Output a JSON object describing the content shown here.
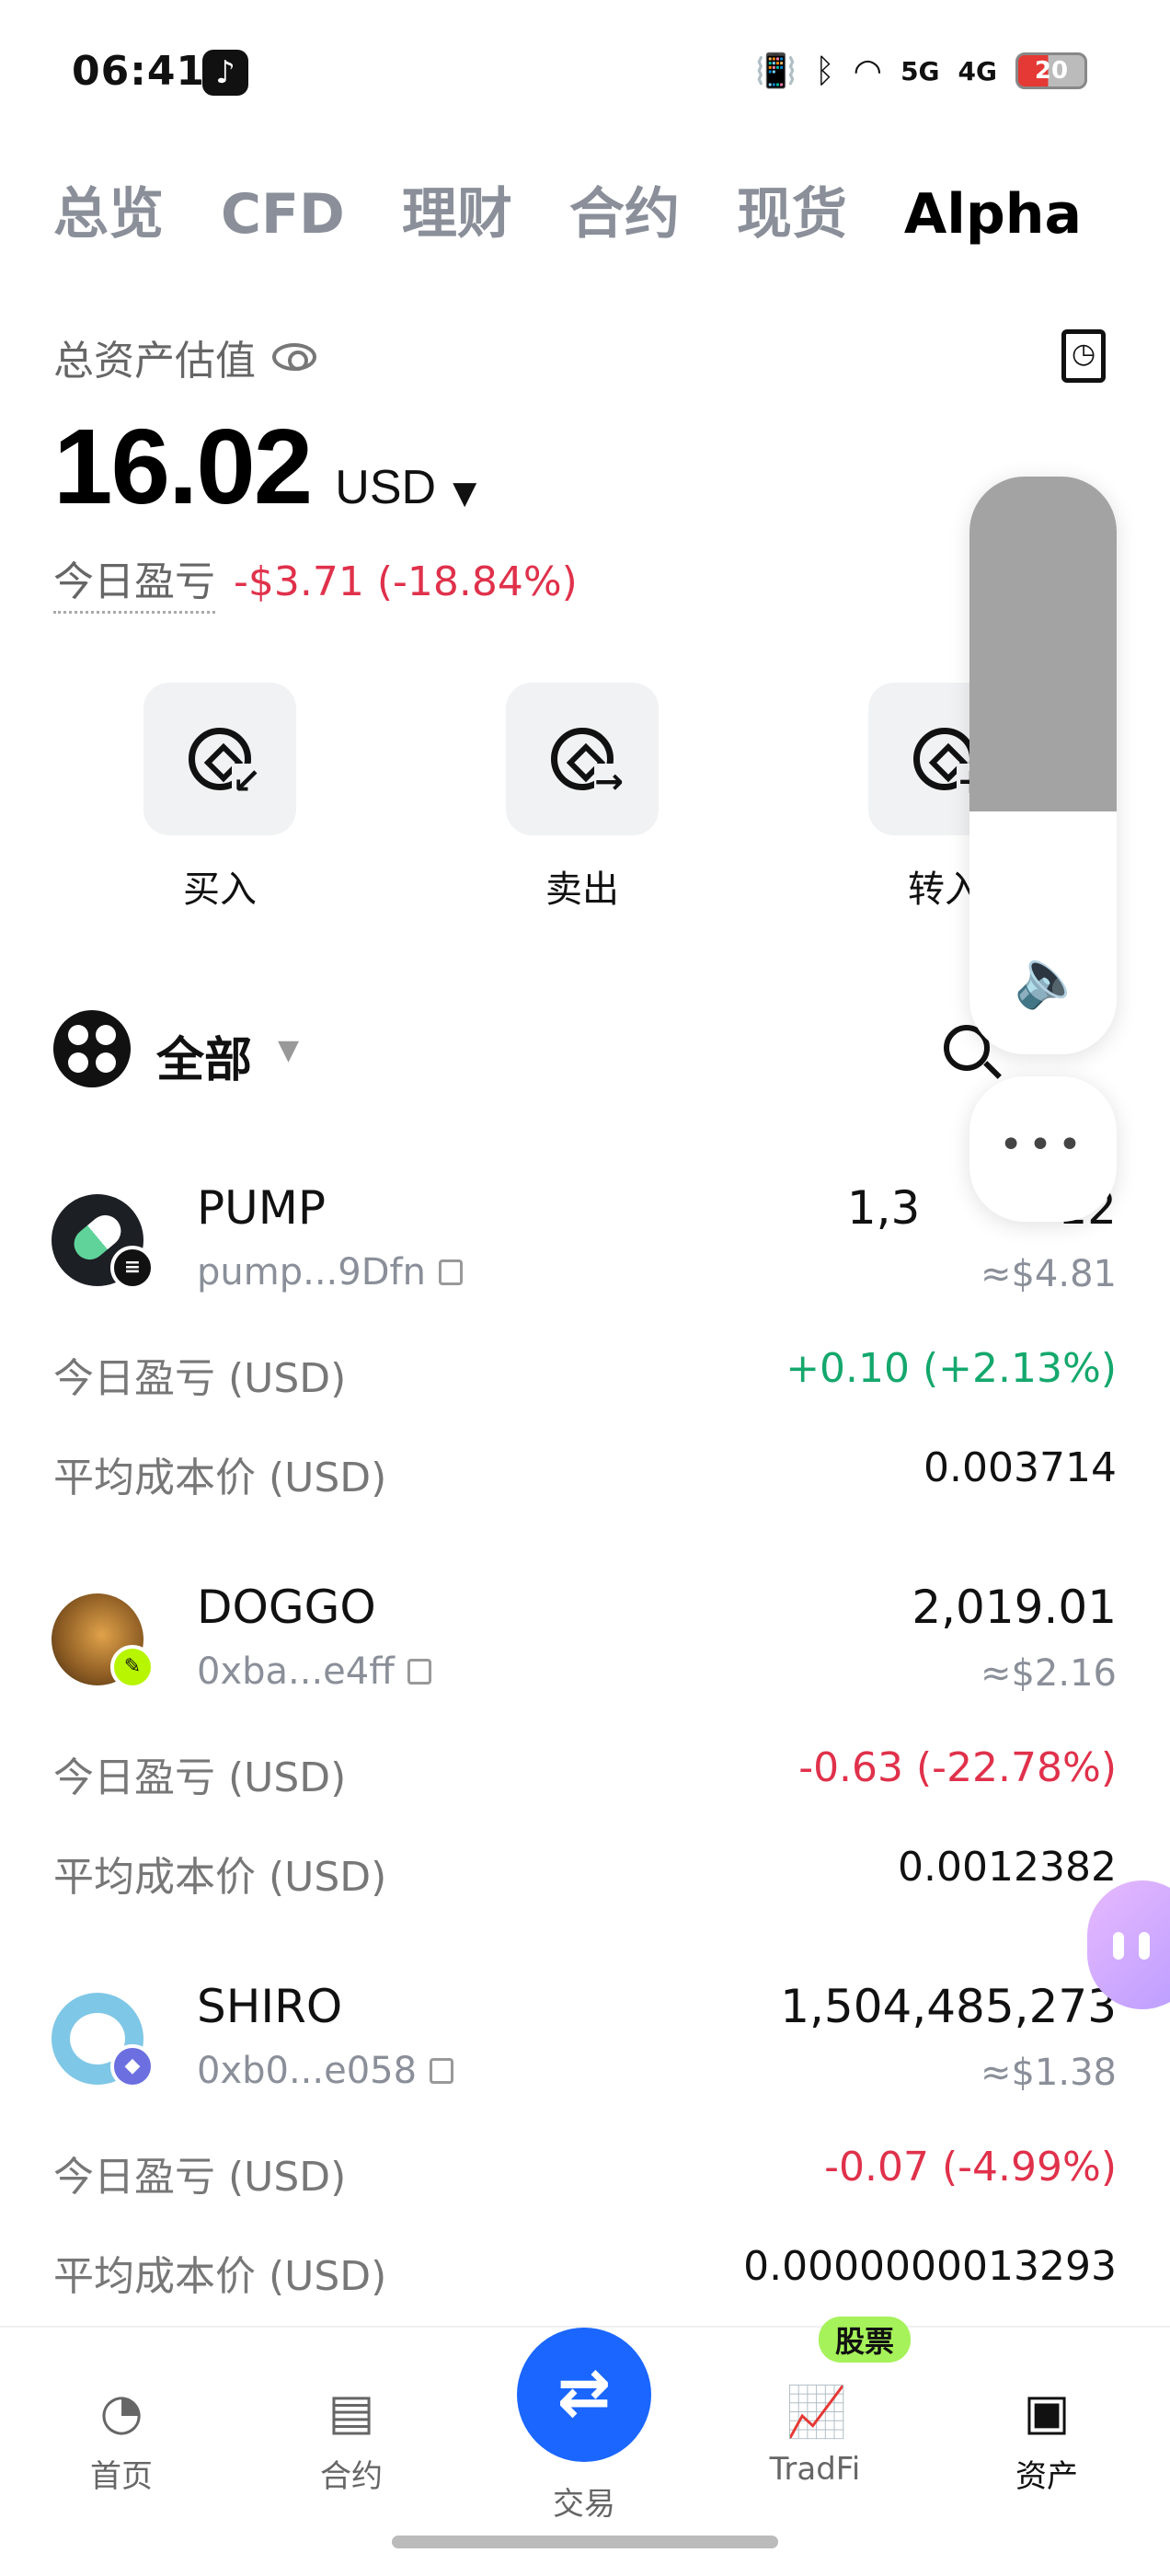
{
  "status_bar": {
    "time": "06:41",
    "network_5g": "5G",
    "network_4g": "4G",
    "battery": "20"
  },
  "tabs": [
    {
      "label": "总览",
      "active": false
    },
    {
      "label": "CFD",
      "active": false
    },
    {
      "label": "理财",
      "active": false
    },
    {
      "label": "合约",
      "active": false
    },
    {
      "label": "现货",
      "active": false
    },
    {
      "label": "Alpha",
      "active": true
    }
  ],
  "summary": {
    "total_label": "总资产估值",
    "balance": "16.02",
    "currency": "USD",
    "pnl_label": "今日盈亏",
    "pnl_value": "-$3.71 (-18.84%)"
  },
  "actions": [
    {
      "label": "买入",
      "icon": "buy-icon"
    },
    {
      "label": "卖出",
      "icon": "sell-icon"
    },
    {
      "label": "转入",
      "icon": "transfer-in-icon"
    }
  ],
  "filter": {
    "label": "全部"
  },
  "tokens": [
    {
      "name": "PUMP",
      "address": "pump...9Dfn",
      "amount": "1,3",
      "amount_tail": "12",
      "usd": "≈$4.81",
      "pnl_label": "今日盈亏 (USD)",
      "pnl_value": "+0.10 (+2.13%)",
      "pnl_color": "#14a86c",
      "cost_label": "平均成本价 (USD)",
      "cost_value": "0.003714",
      "chain": "solana"
    },
    {
      "name": "DOGGO",
      "address": "0xba...e4ff",
      "amount": "2,019.01",
      "usd": "≈$2.16",
      "pnl_label": "今日盈亏 (USD)",
      "pnl_value": "-0.63 (-22.78%)",
      "pnl_color": "#e0314b",
      "cost_label": "平均成本价 (USD)",
      "cost_value": "0.0012382",
      "chain": "four-meme"
    },
    {
      "name": "SHIRO",
      "address": "0xb0...e058",
      "amount": "1,504,485,273",
      "usd": "≈$1.38",
      "pnl_label": "今日盈亏 (USD)",
      "pnl_value": "-0.07 (-4.99%)",
      "pnl_color": "#e0314b",
      "cost_label": "平均成本价 (USD)",
      "cost_value": "0.0000000013293",
      "chain": "ethereum"
    }
  ],
  "volume_overlay": {
    "level": 0.58,
    "more_label": "•••"
  },
  "bottom_nav": {
    "items": [
      {
        "label": "首页",
        "icon": "home-icon"
      },
      {
        "label": "合约",
        "icon": "contract-icon"
      },
      {
        "label": "交易",
        "icon": "trade-icon"
      },
      {
        "label": "TradFi",
        "icon": "tradfi-icon",
        "badge": "股票"
      },
      {
        "label": "资产",
        "icon": "wallet-icon",
        "active": true
      }
    ]
  },
  "colors": {
    "positive": "#14a86c",
    "negative": "#e0314b",
    "accent": "#1a66ff",
    "badge": "#a6f25a"
  }
}
